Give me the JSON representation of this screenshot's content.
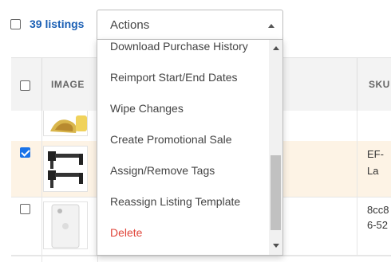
{
  "toolbar": {
    "listings_count": "39 listings",
    "actions_label": "Actions"
  },
  "table": {
    "headers": {
      "image": "IMAGE",
      "sku": "SKU"
    },
    "rows": [
      {
        "selected": false,
        "sku_lines": []
      },
      {
        "selected": true,
        "sku_lines": [
          "EF-La"
        ]
      },
      {
        "selected": false,
        "sku_lines": [
          "8cc8",
          "6-52"
        ]
      }
    ]
  },
  "menu": {
    "items": [
      {
        "label": "Download Purchase History"
      },
      {
        "label": "Reimport Start/End Dates"
      },
      {
        "label": "Wipe Changes"
      },
      {
        "label": "Create Promotional Sale"
      },
      {
        "label": "Assign/Remove Tags"
      },
      {
        "label": "Reassign Listing Template"
      },
      {
        "label": "Delete"
      }
    ]
  },
  "colors": {
    "accent": "#1a73e8",
    "link": "#1a5fb4",
    "selected_row": "#fdf3e5",
    "danger": "#e0453a"
  }
}
